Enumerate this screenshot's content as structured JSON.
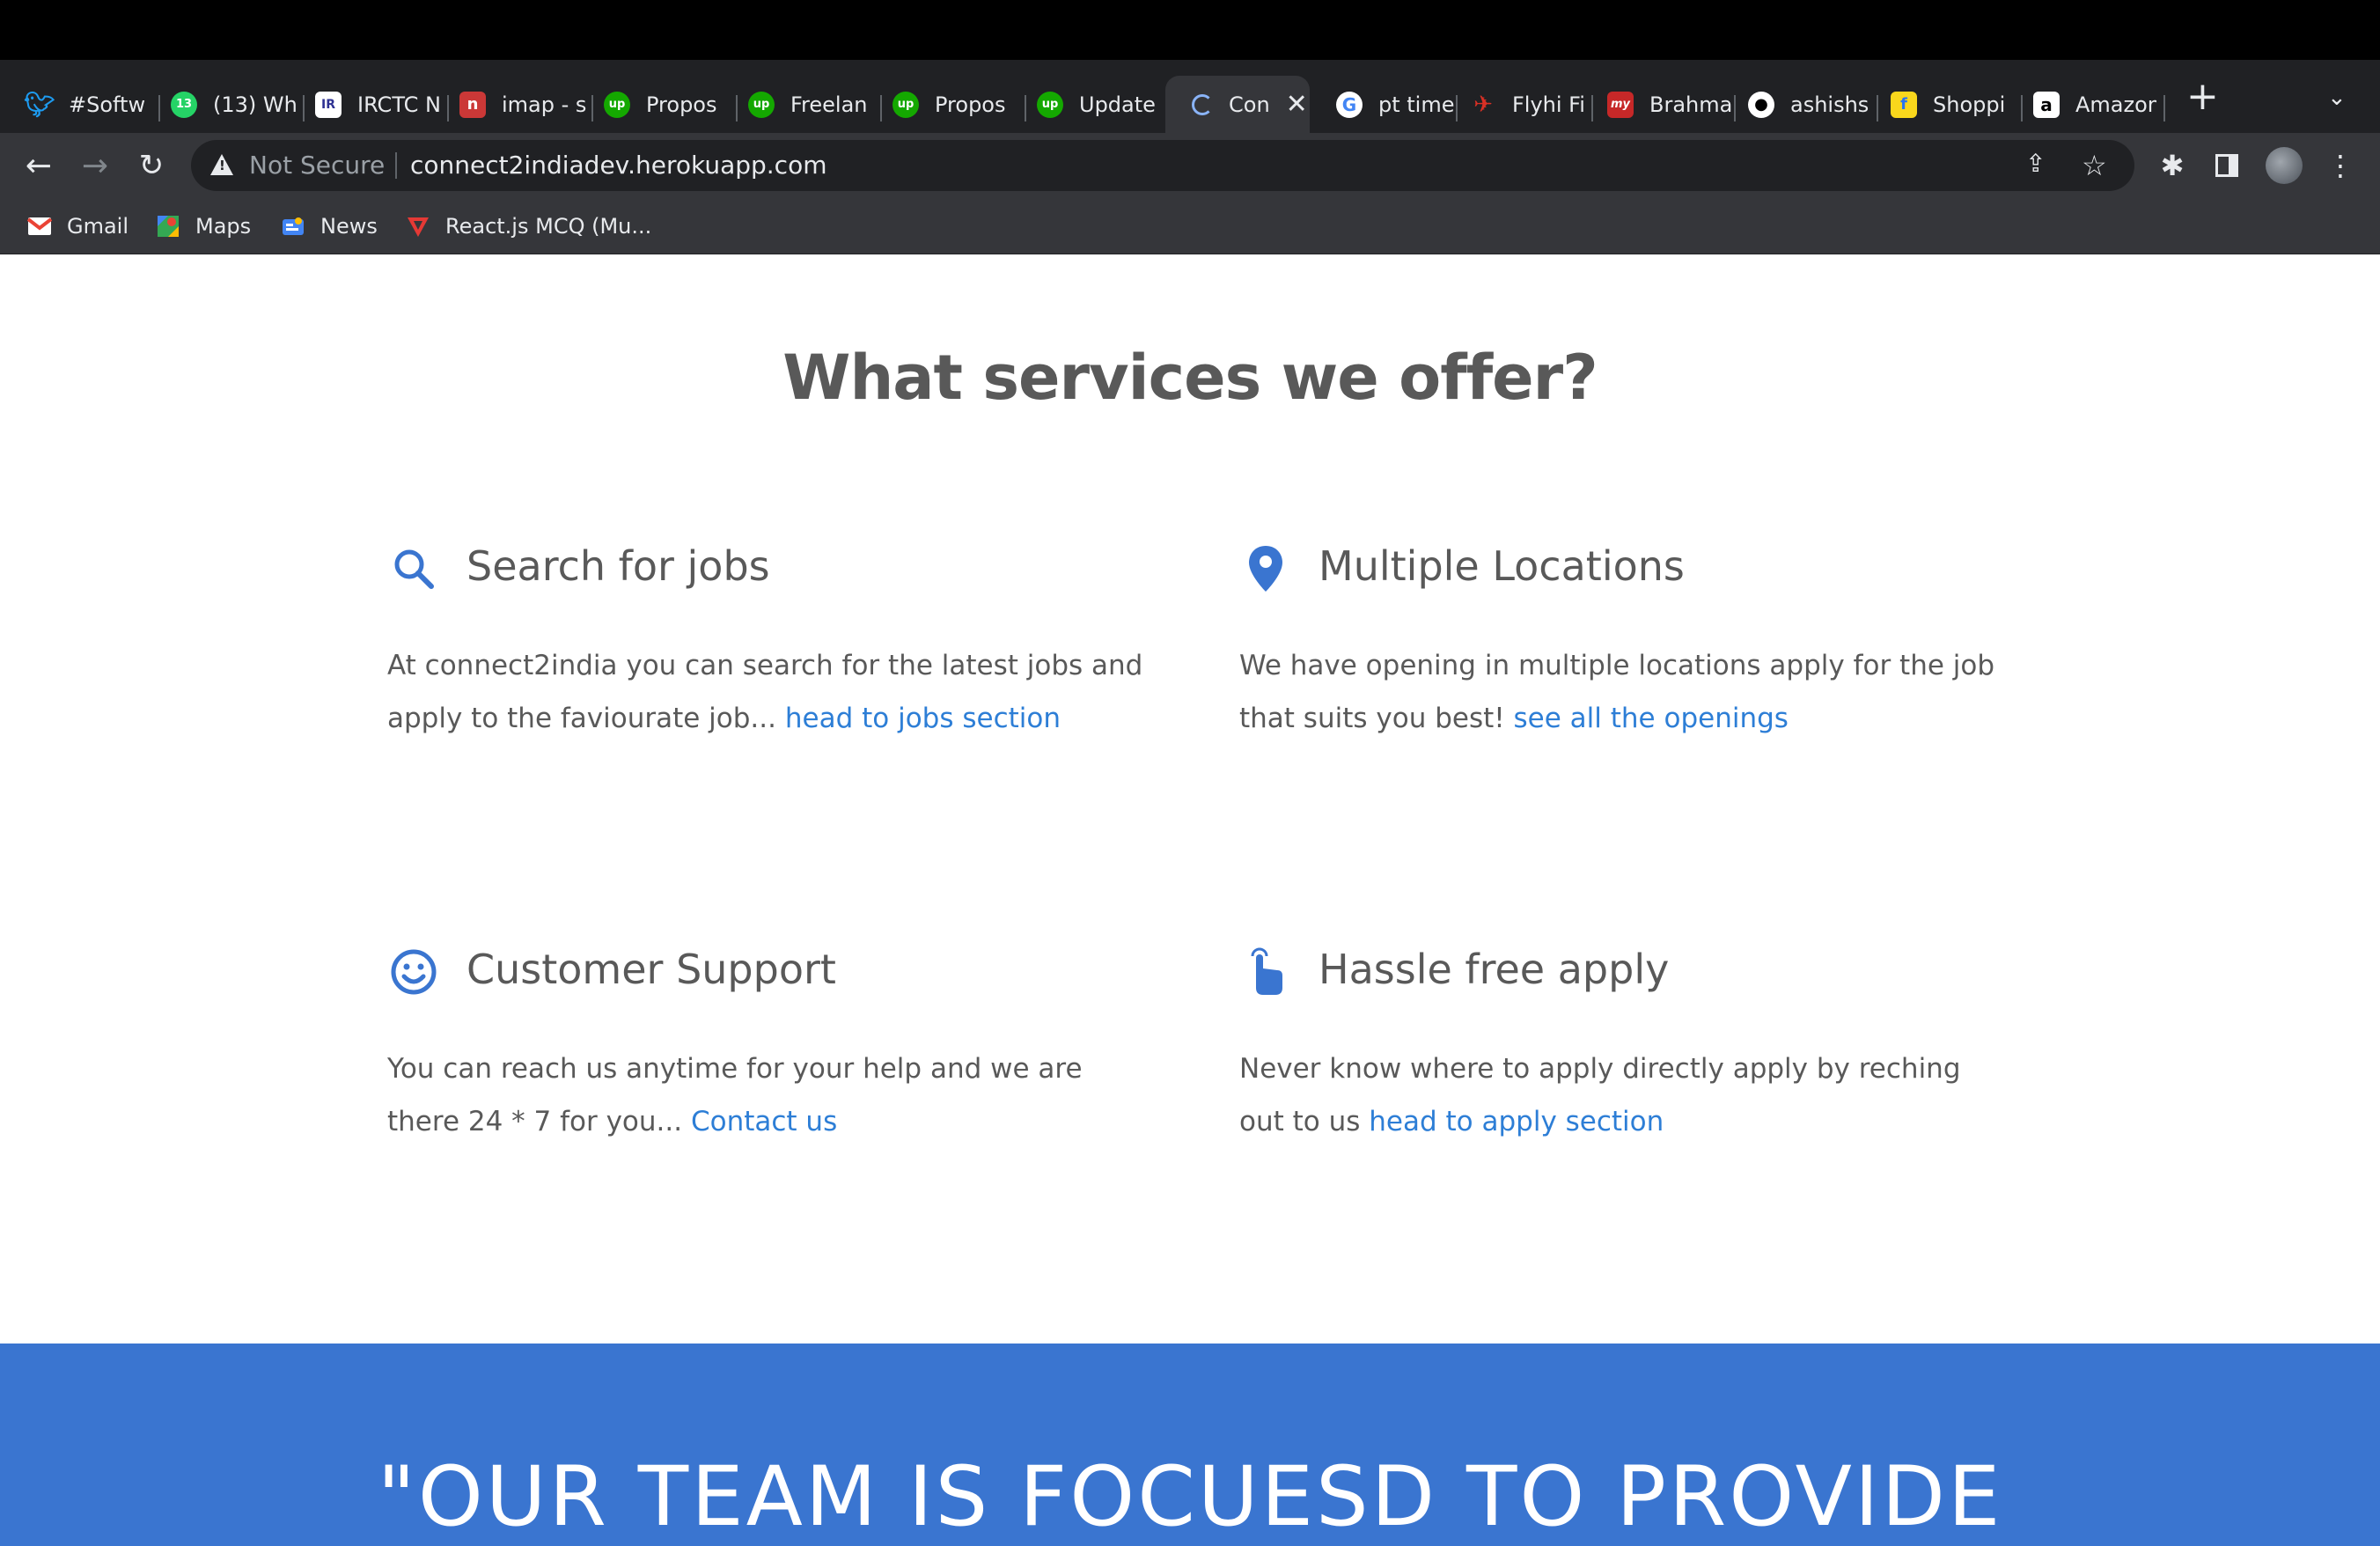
{
  "browser": {
    "tabs": [
      {
        "title": "#Softw",
        "icon": "twitter-icon",
        "color": "#1d9bf0"
      },
      {
        "title": "(13) Wh",
        "icon": "whatsapp-icon",
        "color": "#25d366"
      },
      {
        "title": "IRCTC N",
        "icon": "irctc-icon",
        "color": "#2e3192"
      },
      {
        "title": "imap - s",
        "icon": "npm-icon",
        "color": "#cb3837"
      },
      {
        "title": "Propos",
        "icon": "upwork-icon",
        "color": "#14a800"
      },
      {
        "title": "Freelan",
        "icon": "upwork-icon",
        "color": "#14a800"
      },
      {
        "title": "Propos",
        "icon": "upwork-icon",
        "color": "#14a800"
      },
      {
        "title": "Update",
        "icon": "upwork-icon",
        "color": "#14a800"
      },
      {
        "title": "Con",
        "icon": "loading-icon",
        "color": "#8ab4f8",
        "active": true
      },
      {
        "title": "pt time",
        "icon": "google-icon",
        "color": "#ffffff"
      },
      {
        "title": "Flyhi Fi",
        "icon": "flyhi-icon",
        "color": "#d93025"
      },
      {
        "title": "Brahma",
        "icon": "mybrahma-icon",
        "color": "#c62828"
      },
      {
        "title": "ashishs",
        "icon": "github-icon",
        "color": "#ffffff"
      },
      {
        "title": "Shoppi",
        "icon": "flipkart-icon",
        "color": "#f9d71c"
      },
      {
        "title": "Amazon",
        "icon": "amazon-icon",
        "color": "#ffffff"
      }
    ],
    "omnibox": {
      "security_label": "Not Secure",
      "url": "connect2indiadev.herokuapp.com"
    },
    "bookmarks": [
      {
        "label": "Gmail",
        "icon": "gmail-icon"
      },
      {
        "label": "Maps",
        "icon": "maps-icon"
      },
      {
        "label": "News",
        "icon": "news-icon"
      },
      {
        "label": "React.js MCQ (Mu...",
        "icon": "react-mcq-icon"
      }
    ]
  },
  "page": {
    "heading": "What services we offer?",
    "services": [
      {
        "title": "Search for jobs",
        "icon": "search-icon",
        "desc": "At connect2india you can search for the latest jobs and apply to the faviourate job... ",
        "link": "head to jobs section"
      },
      {
        "title": "Multiple Locations",
        "icon": "location-pin-icon",
        "desc": "We have opening in multiple locations apply for the job that suits you best! ",
        "link": "see all the openings"
      },
      {
        "title": "Customer Support",
        "icon": "smiley-icon",
        "desc": "You can reach us anytime for your help and we are there 24 * 7 for you... ",
        "link": "Contact us"
      },
      {
        "title": "Hassle free apply",
        "icon": "touch-icon",
        "desc": "Never know where to apply directly apply by reching out to us ",
        "link": "head to apply section"
      }
    ],
    "banner": {
      "quote": "\"OUR TEAM IS FOCUESD TO PROVIDE"
    },
    "colors": {
      "accent": "#3a75d0",
      "link": "#2d7ed6",
      "text": "#595959"
    }
  }
}
